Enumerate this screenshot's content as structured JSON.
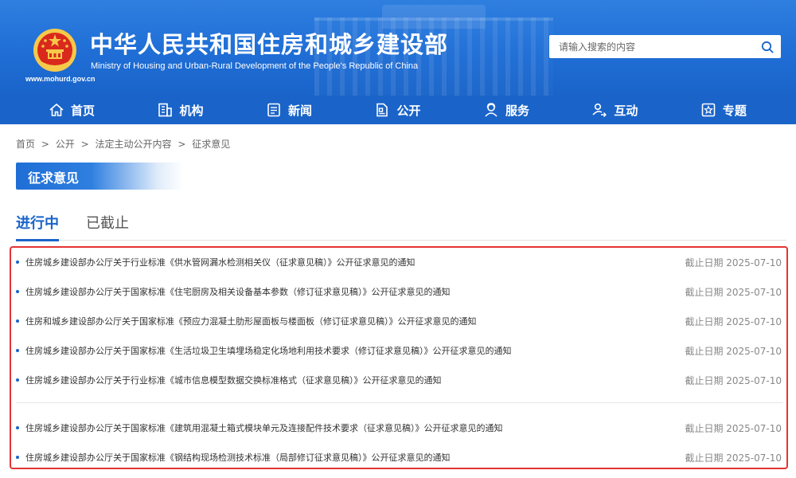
{
  "header": {
    "title": "中华人民共和国住房和城乡建设部",
    "subtitle": "Ministry of Housing and Urban-Rural Development of the People's Republic of China",
    "url": "www.mohurd.gov.cn",
    "search_placeholder": "请输入搜索的内容"
  },
  "nav": {
    "items": [
      {
        "label": "首页",
        "icon": "home-icon"
      },
      {
        "label": "机构",
        "icon": "building-icon"
      },
      {
        "label": "新闻",
        "icon": "news-icon"
      },
      {
        "label": "公开",
        "icon": "document-icon"
      },
      {
        "label": "服务",
        "icon": "service-icon"
      },
      {
        "label": "互动",
        "icon": "interaction-icon"
      },
      {
        "label": "专题",
        "icon": "star-icon"
      }
    ]
  },
  "breadcrumb": {
    "items": [
      "首页",
      "公开",
      "法定主动公开内容",
      "征求意见"
    ],
    "separator": ">"
  },
  "section": {
    "title": "征求意见"
  },
  "tabs": [
    {
      "label": "进行中",
      "active": true
    },
    {
      "label": "已截止",
      "active": false
    }
  ],
  "list": {
    "items": [
      {
        "title": "住房城乡建设部办公厅关于行业标准《供水管网漏水检测相关仪（征求意见稿）》公开征求意见的通知",
        "deadline": "截止日期 2025-07-10"
      },
      {
        "title": "住房城乡建设部办公厅关于国家标准《住宅厨房及相关设备基本参数（修订征求意见稿）》公开征求意见的通知",
        "deadline": "截止日期 2025-07-10"
      },
      {
        "title": "住房和城乡建设部办公厅关于国家标准《预应力混凝土肋形屋面板与楼面板（修订征求意见稿）》公开征求意见的通知",
        "deadline": "截止日期 2025-07-10"
      },
      {
        "title": "住房城乡建设部办公厅关于国家标准《生活垃圾卫生填埋场稳定化场地利用技术要求（修订征求意见稿）》公开征求意见的通知",
        "deadline": "截止日期 2025-07-10"
      },
      {
        "title": "住房城乡建设部办公厅关于行业标准《城市信息模型数据交换标准格式（征求意见稿）》公开征求意见的通知",
        "deadline": "截止日期 2025-07-10"
      },
      {
        "title": "住房城乡建设部办公厅关于国家标准《建筑用混凝土箱式模块单元及连接配件技术要求（征求意见稿）》公开征求意见的通知",
        "deadline": "截止日期 2025-07-10"
      },
      {
        "title": "住房城乡建设部办公厅关于国家标准《钢结构现场检测技术标准（局部修订征求意见稿）》公开征求意见的通知",
        "deadline": "截止日期 2025-07-10"
      }
    ]
  },
  "colors": {
    "primary": "#1a64c9",
    "highlight_border": "#e33333",
    "emblem_red": "#d9291c",
    "emblem_gold": "#f6c94a"
  }
}
